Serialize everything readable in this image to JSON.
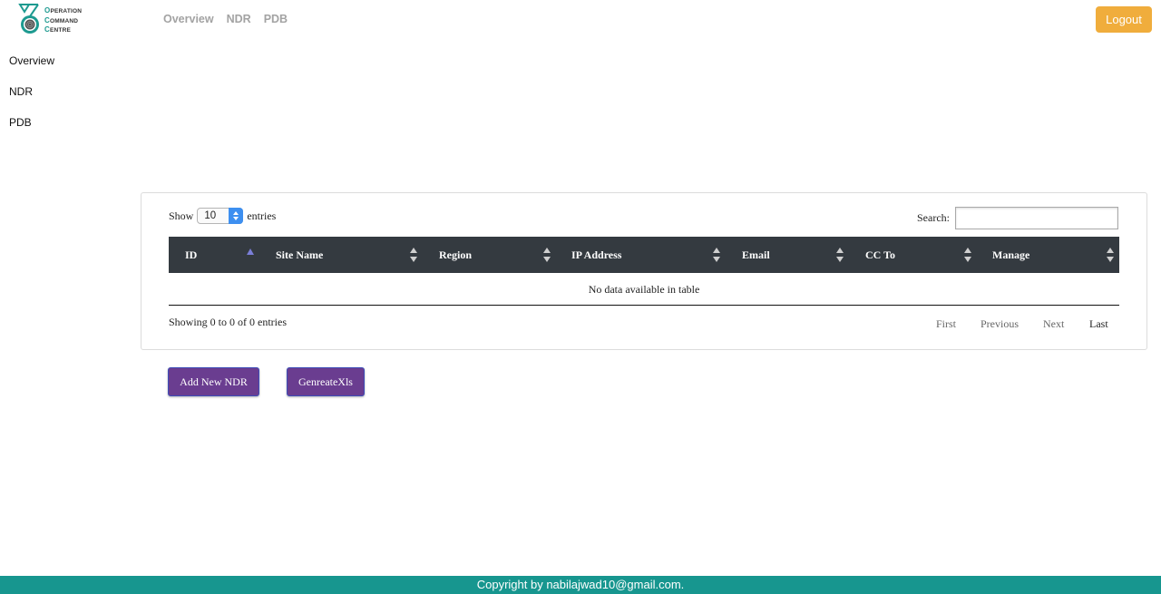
{
  "logo": {
    "line1_cap": "O",
    "line1_rest": "PERATION",
    "line2_cap": "C",
    "line2_rest": "OMMAND",
    "line3_cap": "C",
    "line3_rest": "ENTRE",
    "icon": "operation-command-centre-logo"
  },
  "topnav": [
    "Overview",
    "NDR",
    "PDB"
  ],
  "header": {
    "logout_label": "Logout"
  },
  "sidebar": {
    "items": [
      "Overview",
      "NDR",
      "PDB"
    ]
  },
  "table_controls": {
    "show_label": "Show",
    "entries_value": "10",
    "entries_label": "entries",
    "search_label": "Search:"
  },
  "table": {
    "columns": [
      "ID",
      "Site Name",
      "Region",
      "IP Address",
      "Email",
      "CC To",
      "Manage"
    ],
    "sorted_column": "ID",
    "sort_direction": "ascending",
    "empty_message": "No data available in table"
  },
  "pagination": {
    "info": "Showing 0 to 0 of 0 entries",
    "first": "First",
    "previous": "Previous",
    "next": "Next",
    "last": "Last"
  },
  "actions": {
    "add_label": "Add New NDR",
    "generate_label": "GenreateXls"
  },
  "footer": {
    "copyright": "Copyright by nabilajwad10@gmail.com."
  },
  "colors": {
    "accent_teal": "#17968f",
    "logout_orange": "#f0ad3c",
    "table_header": "#343a40",
    "button_purple": "#6a3d90"
  }
}
